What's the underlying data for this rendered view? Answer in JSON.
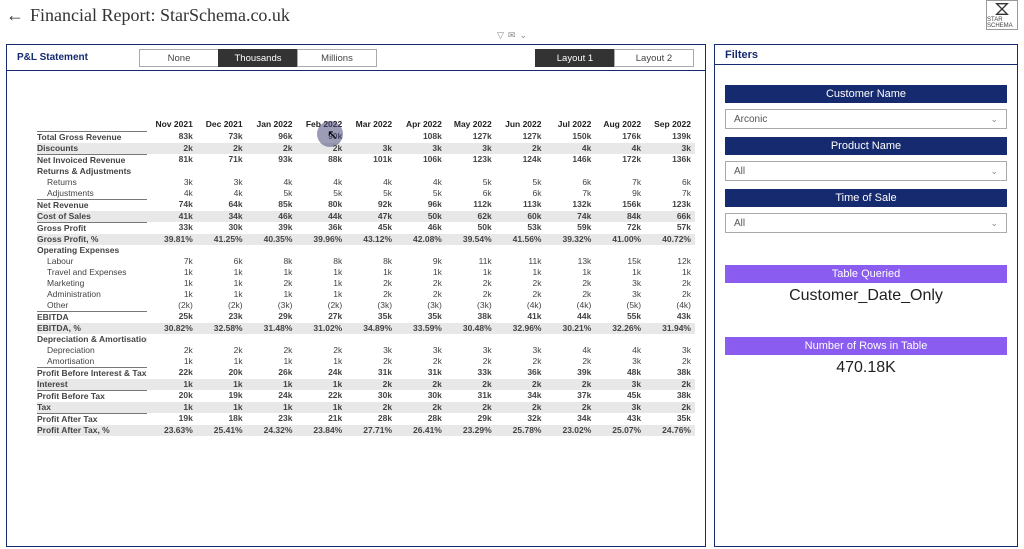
{
  "header": {
    "title": "Financial Report: StarSchema.co.uk",
    "logo_caption": "STAR SCHEMA"
  },
  "controls": {
    "pl_label": "P&L Statement",
    "scale": {
      "options": [
        "None",
        "Thousands",
        "Millions"
      ],
      "selected": "Thousands"
    },
    "layout": {
      "options": [
        "Layout 1",
        "Layout 2"
      ],
      "selected": "Layout 1"
    }
  },
  "columns": [
    "Nov 2021",
    "Dec 2021",
    "Jan 2022",
    "Feb 2022",
    "Mar 2022",
    "Apr 2022",
    "May 2022",
    "Jun 2022",
    "Jul 2022",
    "Aug 2022",
    "Sep 2022"
  ],
  "rows": [
    {
      "label": "Total Gross Revenue",
      "cls": "bold section-start",
      "v": [
        "83k",
        "73k",
        "96k",
        "90k",
        "",
        "108k",
        "127k",
        "127k",
        "150k",
        "176k",
        "139k"
      ]
    },
    {
      "label": "Discounts",
      "cls": "bold shade",
      "v": [
        "2k",
        "2k",
        "2k",
        "2k",
        "3k",
        "3k",
        "3k",
        "2k",
        "4k",
        "4k",
        "3k"
      ]
    },
    {
      "label": "Net Invoiced Revenue",
      "cls": "bold section-start",
      "v": [
        "81k",
        "71k",
        "93k",
        "88k",
        "101k",
        "106k",
        "123k",
        "124k",
        "146k",
        "172k",
        "136k"
      ]
    },
    {
      "label": "Returns & Adjustments",
      "cls": "bold",
      "v": [
        "",
        "",
        "",
        "",
        "",
        "",
        "",
        "",
        "",
        "",
        ""
      ]
    },
    {
      "label": "Returns",
      "cls": "indent",
      "v": [
        "3k",
        "3k",
        "4k",
        "4k",
        "4k",
        "4k",
        "5k",
        "5k",
        "6k",
        "7k",
        "6k"
      ]
    },
    {
      "label": "Adjustments",
      "cls": "indent",
      "v": [
        "4k",
        "4k",
        "5k",
        "5k",
        "5k",
        "5k",
        "6k",
        "6k",
        "7k",
        "9k",
        "7k"
      ]
    },
    {
      "label": "Net Revenue",
      "cls": "bold section-start",
      "v": [
        "74k",
        "64k",
        "85k",
        "80k",
        "92k",
        "96k",
        "112k",
        "113k",
        "132k",
        "156k",
        "123k"
      ]
    },
    {
      "label": "Cost of Sales",
      "cls": "bold shade",
      "v": [
        "41k",
        "34k",
        "46k",
        "44k",
        "47k",
        "50k",
        "62k",
        "60k",
        "74k",
        "84k",
        "66k"
      ]
    },
    {
      "label": "Gross Profit",
      "cls": "bold section-start",
      "v": [
        "33k",
        "30k",
        "39k",
        "36k",
        "45k",
        "46k",
        "50k",
        "53k",
        "59k",
        "72k",
        "57k"
      ]
    },
    {
      "label": "Gross Profit, %",
      "cls": "bold shade",
      "v": [
        "39.81%",
        "41.25%",
        "40.35%",
        "39.96%",
        "43.12%",
        "42.08%",
        "39.54%",
        "41.56%",
        "39.32%",
        "41.00%",
        "40.72%"
      ]
    },
    {
      "label": "Operating Expenses",
      "cls": "bold",
      "v": [
        "",
        "",
        "",
        "",
        "",
        "",
        "",
        "",
        "",
        "",
        ""
      ]
    },
    {
      "label": "Labour",
      "cls": "indent",
      "v": [
        "7k",
        "6k",
        "8k",
        "8k",
        "8k",
        "9k",
        "11k",
        "11k",
        "13k",
        "15k",
        "12k"
      ]
    },
    {
      "label": "Travel and Expenses",
      "cls": "indent",
      "v": [
        "1k",
        "1k",
        "1k",
        "1k",
        "1k",
        "1k",
        "1k",
        "1k",
        "1k",
        "1k",
        "1k"
      ]
    },
    {
      "label": "Marketing",
      "cls": "indent",
      "v": [
        "1k",
        "1k",
        "2k",
        "1k",
        "2k",
        "2k",
        "2k",
        "2k",
        "2k",
        "3k",
        "2k"
      ]
    },
    {
      "label": "Administration",
      "cls": "indent",
      "v": [
        "1k",
        "1k",
        "1k",
        "1k",
        "2k",
        "2k",
        "2k",
        "2k",
        "2k",
        "3k",
        "2k"
      ]
    },
    {
      "label": "Other",
      "cls": "indent",
      "v": [
        "(2k)",
        "(2k)",
        "(3k)",
        "(2k)",
        "(3k)",
        "(3k)",
        "(3k)",
        "(4k)",
        "(4k)",
        "(5k)",
        "(4k)"
      ]
    },
    {
      "label": "EBITDA",
      "cls": "bold section-start",
      "v": [
        "25k",
        "23k",
        "29k",
        "27k",
        "35k",
        "35k",
        "38k",
        "41k",
        "44k",
        "55k",
        "43k"
      ]
    },
    {
      "label": "EBITDA, %",
      "cls": "bold shade",
      "v": [
        "30.82%",
        "32.58%",
        "31.48%",
        "31.02%",
        "34.89%",
        "33.59%",
        "30.48%",
        "32.96%",
        "30.21%",
        "32.26%",
        "31.94%"
      ]
    },
    {
      "label": "Depreciation & Amortisation",
      "cls": "bold",
      "v": [
        "",
        "",
        "",
        "",
        "",
        "",
        "",
        "",
        "",
        "",
        ""
      ]
    },
    {
      "label": "Depreciation",
      "cls": "indent",
      "v": [
        "2k",
        "2k",
        "2k",
        "2k",
        "3k",
        "3k",
        "3k",
        "3k",
        "4k",
        "4k",
        "3k"
      ]
    },
    {
      "label": "Amortisation",
      "cls": "indent",
      "v": [
        "1k",
        "1k",
        "1k",
        "1k",
        "2k",
        "2k",
        "2k",
        "2k",
        "2k",
        "3k",
        "2k"
      ]
    },
    {
      "label": "Profit Before Interest & Tax",
      "cls": "bold section-start",
      "v": [
        "22k",
        "20k",
        "26k",
        "24k",
        "31k",
        "31k",
        "33k",
        "36k",
        "39k",
        "48k",
        "38k"
      ]
    },
    {
      "label": "Interest",
      "cls": "bold shade",
      "v": [
        "1k",
        "1k",
        "1k",
        "1k",
        "2k",
        "2k",
        "2k",
        "2k",
        "2k",
        "3k",
        "2k"
      ]
    },
    {
      "label": "Profit Before Tax",
      "cls": "bold section-start",
      "v": [
        "20k",
        "19k",
        "24k",
        "22k",
        "30k",
        "30k",
        "31k",
        "34k",
        "37k",
        "45k",
        "38k"
      ]
    },
    {
      "label": "Tax",
      "cls": "bold shade",
      "v": [
        "1k",
        "1k",
        "1k",
        "1k",
        "2k",
        "2k",
        "2k",
        "2k",
        "2k",
        "3k",
        "2k"
      ]
    },
    {
      "label": "Profit After Tax",
      "cls": "bold section-start",
      "v": [
        "19k",
        "18k",
        "23k",
        "21k",
        "28k",
        "28k",
        "29k",
        "32k",
        "34k",
        "43k",
        "35k"
      ]
    },
    {
      "label": "Profit After Tax, %",
      "cls": "bold shade",
      "v": [
        "23.63%",
        "25.41%",
        "24.32%",
        "23.84%",
        "27.71%",
        "26.41%",
        "23.29%",
        "25.78%",
        "23.02%",
        "25.07%",
        "24.76%"
      ]
    }
  ],
  "filters": {
    "panel_label": "Filters",
    "customer": {
      "head": "Customer Name",
      "value": "Arconic"
    },
    "product": {
      "head": "Product Name",
      "value": "All"
    },
    "time": {
      "head": "Time of Sale",
      "value": "All"
    }
  },
  "info": {
    "table_head": "Table Queried",
    "table_value": "Customer_Date_Only",
    "rows_head": "Number of Rows in Table",
    "rows_value": "470.18K"
  }
}
